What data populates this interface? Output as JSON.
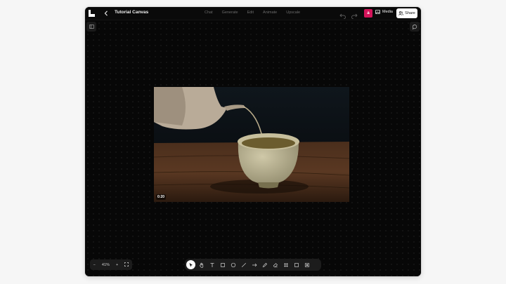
{
  "topbar": {
    "title": "Tutorial Canvas",
    "nav": [
      "Chat",
      "Generate",
      "Edit",
      "Animate",
      "Upscale"
    ],
    "avatar_letter": "a",
    "media_label": "Media",
    "share_label": "Share"
  },
  "video": {
    "duration": "0:20"
  },
  "zoom": {
    "minus": "−",
    "level": "41%",
    "plus": "+"
  },
  "tools": [
    "select-tool",
    "hand-tool",
    "text-tool",
    "rectangle-tool",
    "ellipse-tool",
    "line-tool",
    "arrow-tool",
    "pen-tool",
    "eraser-tool",
    "grid-tool",
    "frame-tool",
    "crop-tool"
  ],
  "colors": {
    "accent": "#d4145a",
    "canvas": "#070707",
    "page_background": "#f6f6f6"
  }
}
